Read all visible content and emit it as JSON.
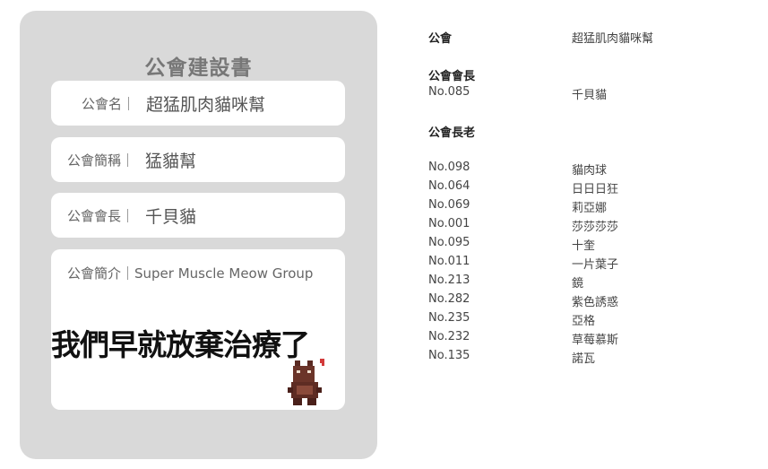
{
  "panel": {
    "title": "公會建設書",
    "name_label": "公會名｜",
    "name_value": "超猛肌肉貓咪幫",
    "abbr_label": "公會簡稱｜",
    "abbr_value": "猛貓幫",
    "leader_label": "公會會長｜",
    "leader_value": "千貝貓",
    "intro_label": "公會簡介｜Super Muscle Meow Group",
    "slogan": "我們早就放棄治療了"
  },
  "info": {
    "guild_label": "公會",
    "guild_value": "超猛肌肉貓咪幫",
    "leader_heading": "公會會長",
    "leader": {
      "no": "No.085",
      "name": "千貝貓"
    },
    "elders_heading": "公會長老",
    "elders": [
      {
        "no": "No.098",
        "name": "貓肉球"
      },
      {
        "no": "No.064",
        "name": "日日日狂"
      },
      {
        "no": "No.069",
        "name": "莉亞娜"
      },
      {
        "no": "No.001",
        "name": "莎莎莎莎"
      },
      {
        "no": "No.095",
        "name": "十奎"
      },
      {
        "no": "No.011",
        "name": "一片葉子"
      },
      {
        "no": "No.213",
        "name": "鏡"
      },
      {
        "no": "No.282",
        "name": "紫色誘惑"
      },
      {
        "no": "No.235",
        "name": "亞格"
      },
      {
        "no": "No.232",
        "name": "草莓慕斯"
      },
      {
        "no": "No.135",
        "name": "諾瓦"
      }
    ]
  }
}
